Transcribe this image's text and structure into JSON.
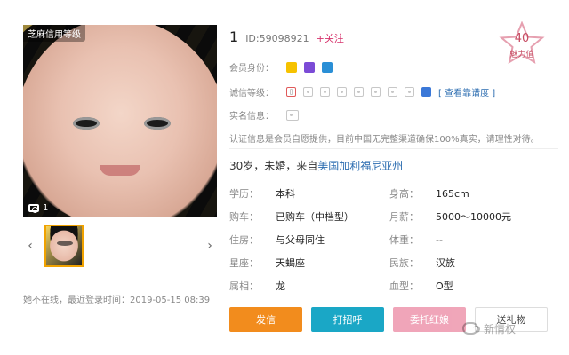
{
  "left": {
    "photo_badge": "芝麻信用等级",
    "photo_count": "1",
    "last_login": "她不在线，最近登录时间：2019-05-15 08:39"
  },
  "profile": {
    "name": "1",
    "id": "ID:59098921",
    "follow": "+关注",
    "charm_value": "40",
    "charm_label": "魅力值",
    "member_label": "会员身份：",
    "credit_label": "诚信等级：",
    "credit_link": "[ 查看靠谱度 ]",
    "realname_label": "实名信息：",
    "info_text": "认证信息是会员自愿提供，目前中国无完整渠道确保100%真实，请理性对待。",
    "bio_prefix": "30岁，未婚，来自",
    "bio_location": "美国加利福尼亚州"
  },
  "details": [
    {
      "k": "学历：",
      "v": "本科"
    },
    {
      "k": "身高：",
      "v": "165cm"
    },
    {
      "k": "购车：",
      "v": "已购车（中档型）"
    },
    {
      "k": "月薪：",
      "v": "5000～10000元"
    },
    {
      "k": "住房：",
      "v": "与父母同住"
    },
    {
      "k": "体重：",
      "v": "--"
    },
    {
      "k": "星座：",
      "v": "天蝎座"
    },
    {
      "k": "民族：",
      "v": "汉族"
    },
    {
      "k": "属相：",
      "v": "龙"
    },
    {
      "k": "血型：",
      "v": "O型"
    }
  ],
  "actions": {
    "send": "发信",
    "hi": "打招呼",
    "gift": "委托红娘",
    "present": "送礼物"
  },
  "watermark": "新情权"
}
